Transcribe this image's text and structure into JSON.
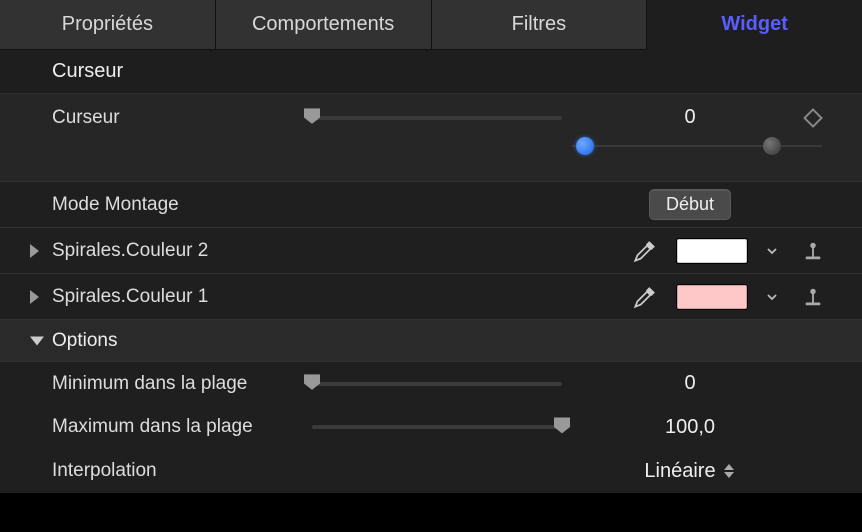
{
  "tabs": {
    "properties": "Propriétés",
    "behaviors": "Comportements",
    "filters": "Filtres",
    "widget": "Widget"
  },
  "section": {
    "title": "Curseur"
  },
  "cursor": {
    "label": "Curseur",
    "value": "0",
    "slider_percent": 0,
    "snap_a_percent": 5,
    "snap_b_percent": 80
  },
  "edit_mode": {
    "label": "Mode Montage",
    "button": "Début"
  },
  "params": [
    {
      "label": "Spirales.Couleur 2",
      "color": "#ffffff"
    },
    {
      "label": "Spirales.Couleur 1",
      "color": "#ffc8c8"
    }
  ],
  "options": {
    "header": "Options",
    "min": {
      "label": "Minimum dans la plage",
      "value": "0",
      "percent": 0
    },
    "max": {
      "label": "Maximum dans la plage",
      "value": "100,0",
      "percent": 100
    },
    "interp": {
      "label": "Interpolation",
      "value": "Linéaire"
    }
  }
}
